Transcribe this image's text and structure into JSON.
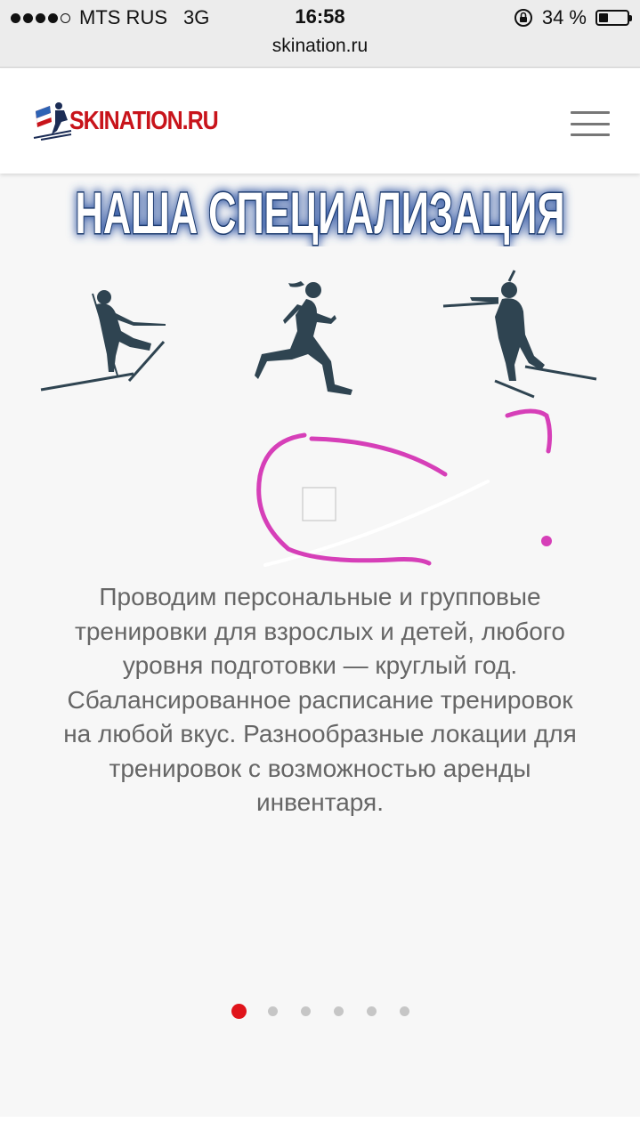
{
  "status_bar": {
    "carrier": "MTS RUS",
    "network": "3G",
    "time": "16:58",
    "battery": "34 %",
    "battery_level": 0.34
  },
  "browser": {
    "url": "skination.ru"
  },
  "header": {
    "logo_text": "SKINATION.RU"
  },
  "section": {
    "title": "НАША СПЕЦИАЛИЗАЦИЯ",
    "description_lines": [
      "Проводим персональные и групповые",
      "тренировки для взрослых и детей, любого",
      "уровня подготовки — круглый год.",
      "Сбалансированное расписание тренировок",
      "на любой вкус. Разнообразные локации для",
      "тренировок с возможностью аренды",
      "инвентаря."
    ]
  },
  "carousel": {
    "count": 6,
    "active_index": 0
  },
  "colors": {
    "brand_red": "#e0141b",
    "title_blue": "#1d3b6e",
    "annotation_magenta": "#d63fb8",
    "silhouette": "#2f4451"
  }
}
